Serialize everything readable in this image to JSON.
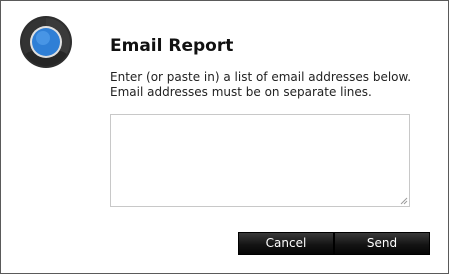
{
  "dialog": {
    "title": "Email Report",
    "instructions_line1": "Enter (or paste in) a list of email addresses below.",
    "instructions_line2": "Email addresses must be on separate lines.",
    "email_list_value": "",
    "email_list_placeholder": "",
    "cancel_label": "Cancel",
    "send_label": "Send"
  },
  "icons": {
    "logo": "app-logo-icon",
    "resize_grip": "resize-grip-icon"
  },
  "colors": {
    "logo_blue": "#2f7fd6",
    "logo_dark": "#2e2e2e",
    "button_dark": "#141414",
    "border": "#5a5a5a"
  }
}
